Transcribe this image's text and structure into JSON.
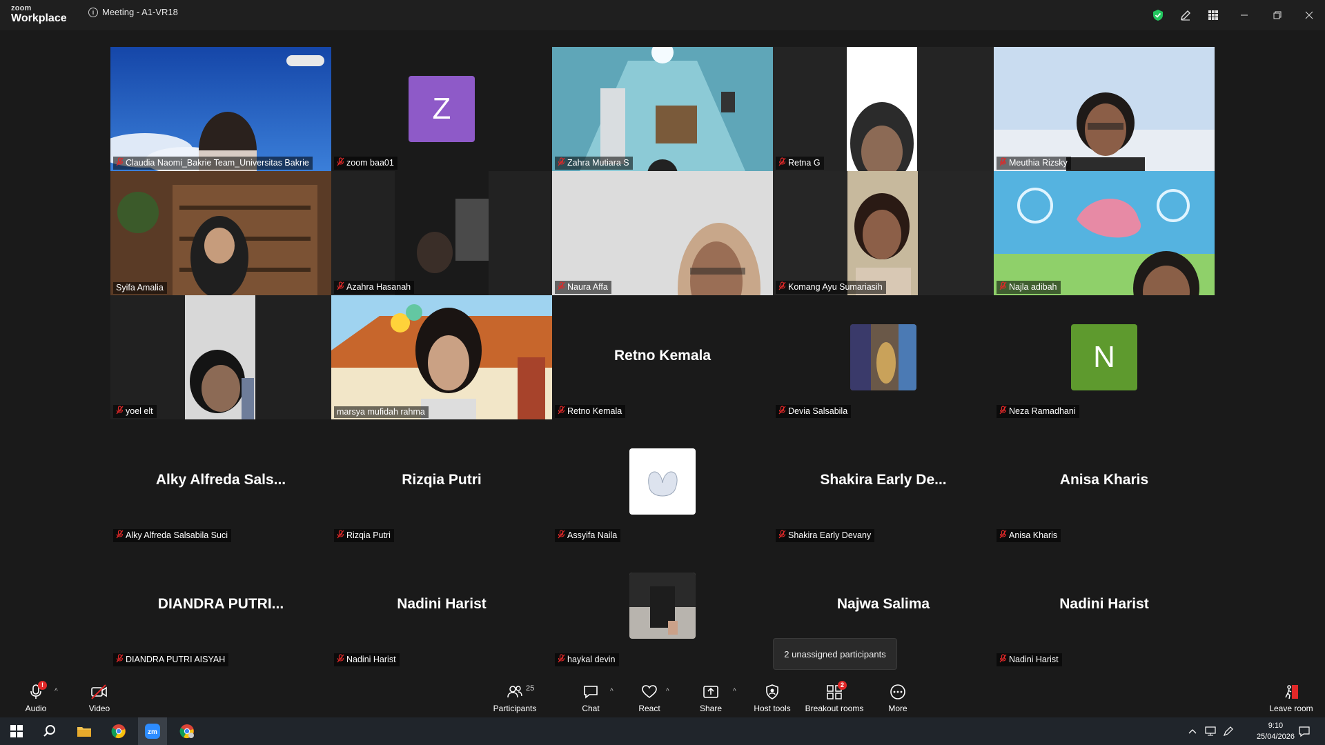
{
  "app": {
    "logo_small": "zoom",
    "logo_big": "Workplace",
    "meeting_title": "Meeting - A1-VR18"
  },
  "tiles": [
    {
      "name": "Claudia Naomi_Bakrie Team_Universitas Bakrie",
      "kind": "video",
      "muted": true
    },
    {
      "name": "zoom baa01",
      "kind": "avatar",
      "initial": "Z",
      "color": "#8e5ac8",
      "muted": true
    },
    {
      "name": "Zahra Mutiara S",
      "kind": "video",
      "muted": true
    },
    {
      "name": "Retna G",
      "kind": "video",
      "muted": true
    },
    {
      "name": "Meuthia Rizsky",
      "kind": "video",
      "muted": true
    },
    {
      "name": "Syifa Amalia",
      "kind": "video",
      "muted": false
    },
    {
      "name": "Azahra Hasanah",
      "kind": "video",
      "muted": true
    },
    {
      "name": "Naura Affa",
      "kind": "video",
      "muted": true
    },
    {
      "name": "Komang Ayu Sumariasih",
      "kind": "video",
      "muted": true
    },
    {
      "name": "Najla adibah",
      "kind": "video",
      "muted": true
    },
    {
      "name": "yoel elt",
      "kind": "video",
      "muted": true
    },
    {
      "name": "marsya mufidah rahma",
      "kind": "video",
      "muted": false,
      "active": true
    },
    {
      "name": "Retno Kemala",
      "kind": "name",
      "display": "Retno Kemala",
      "muted": true
    },
    {
      "name": "Devia Salsabila",
      "kind": "photo",
      "muted": true
    },
    {
      "name": "Neza Ramadhani",
      "kind": "avatar",
      "initial": "N",
      "color": "#5e9a2e",
      "muted": true
    },
    {
      "name": "Alky Alfreda Salsabila Suci",
      "kind": "name",
      "display": "Alky  Alfreda  Sals...",
      "muted": true
    },
    {
      "name": "Rizqia Putri",
      "kind": "name",
      "display": "Rizqia Putri",
      "muted": true
    },
    {
      "name": "Assyifa Naila",
      "kind": "photo",
      "muted": true
    },
    {
      "name": "Shakira Early Devany",
      "kind": "name",
      "display": "Shakira  Early  De...",
      "muted": true
    },
    {
      "name": "Anisa Kharis",
      "kind": "name",
      "display": "Anisa Kharis",
      "muted": true
    },
    {
      "name": "DIANDRA PUTRI AISYAH",
      "kind": "name",
      "display": "DIANDRA  PUTRI...",
      "muted": true
    },
    {
      "name": "Nadini Harist",
      "kind": "name",
      "display": "Nadini Harist",
      "muted": true
    },
    {
      "name": "haykal devin",
      "kind": "photo",
      "muted": true
    },
    {
      "name": "",
      "kind": "name",
      "display": "Najwa Salima",
      "muted": false,
      "nolabel": true
    },
    {
      "name": "Nadini Harist",
      "kind": "name",
      "display": "Nadini Harist",
      "muted": true
    }
  ],
  "tooltip": "2 unassigned participants",
  "toolbar": {
    "audio": "Audio",
    "audio_badge": "!",
    "video": "Video",
    "participants": "Participants",
    "participants_count": "25",
    "chat": "Chat",
    "react": "React",
    "share": "Share",
    "host_tools": "Host tools",
    "breakout": "Breakout rooms",
    "breakout_badge": "2",
    "more": "More",
    "leave": "Leave room"
  },
  "taskbar": {
    "time": "9:10",
    "date": "25/04/2026"
  },
  "colors": {
    "active_border": "#2ecc71",
    "mute_red": "#e02828",
    "shield_green": "#22c55e"
  }
}
